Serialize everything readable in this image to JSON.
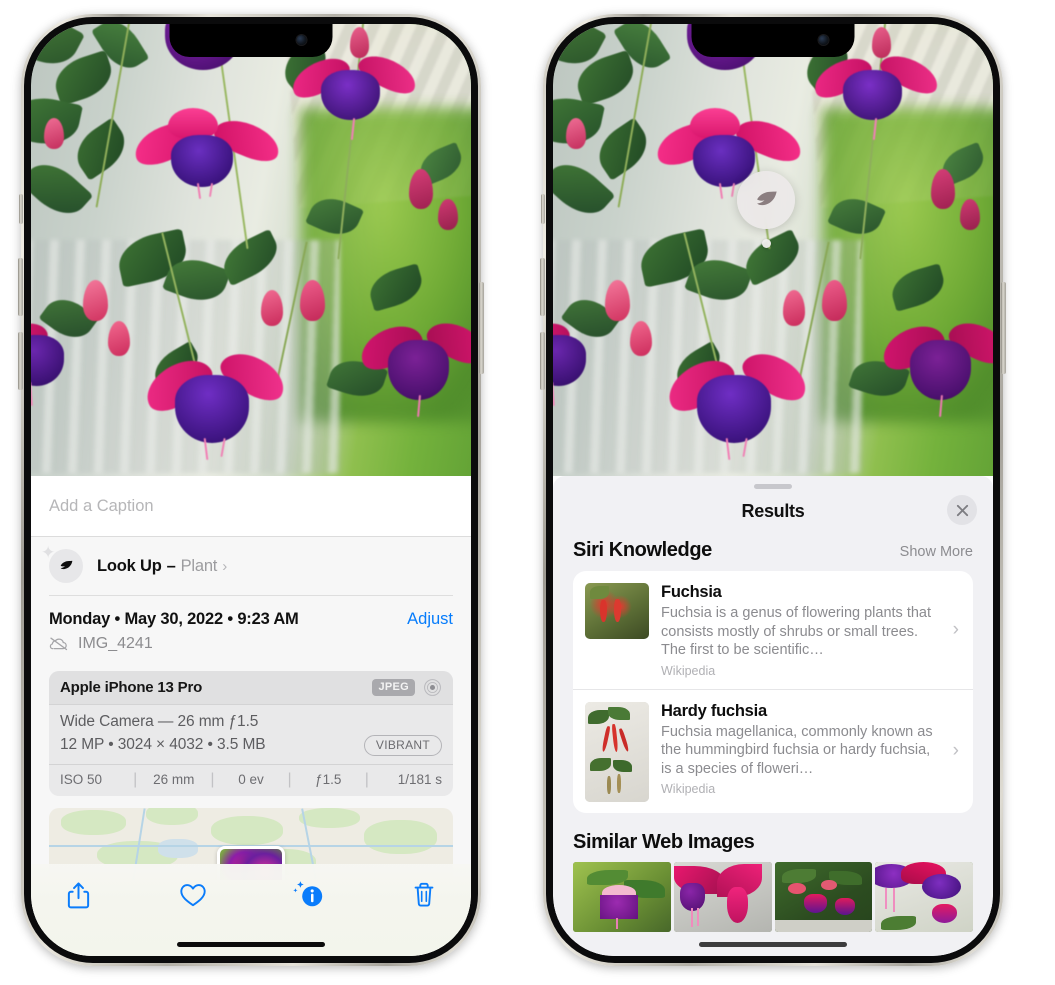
{
  "screenshot": {
    "description": "Two iPhone 13 Pro screenshots side by side showing Apple Photos Visual Look Up for a fuchsia plant"
  },
  "left_phone": {
    "device_name": "iPhone 13 Pro",
    "photo": {
      "subject": "fuchsia flowers",
      "alt": "Close-up of pink and purple fuchsia blossoms hanging from a plant on a porch"
    },
    "caption_field": {
      "placeholder": "Add a Caption",
      "value": ""
    },
    "lookup_row": {
      "icon": "leaf-icon",
      "sparkle_icon": "sparkle-icon",
      "label": "Look Up",
      "separator": "–",
      "subject": "Plant",
      "chevron": "›"
    },
    "date_row": {
      "weekday": "Monday",
      "dot1": "•",
      "date": "May 30, 2022",
      "dot2": "•",
      "time": "9:23 AM",
      "full": "Monday • May 30, 2022 • 9:23 AM",
      "adjust_label": "Adjust"
    },
    "file_row": {
      "icon": "cloud-slash-icon",
      "filename": "IMG_4241"
    },
    "camera_card": {
      "model": "Apple iPhone 13 Pro",
      "format_badge": "JPEG",
      "hdr_icon": "hdr-aperture-icon",
      "lens": "Wide Camera — 26 mm ƒ1.5",
      "specs": "12 MP • 3024 × 4032 • 3.5 MB",
      "style_badge": "VIBRANT",
      "exif": [
        "ISO 50",
        "26 mm",
        "0 ev",
        "ƒ1.5",
        "1/181 s"
      ]
    },
    "map": {
      "label": "location-map-thumbnail"
    },
    "toolbar": [
      {
        "name": "share-icon",
        "label": "Share"
      },
      {
        "name": "heart-icon",
        "label": "Favorite"
      },
      {
        "name": "info-sparkle-icon",
        "label": "Info"
      },
      {
        "name": "trash-icon",
        "label": "Delete"
      }
    ],
    "accent_color": "#067cfb"
  },
  "right_phone": {
    "device_name": "iPhone 13 Pro",
    "visual_look_up_badge": {
      "icon": "leaf-icon",
      "label": "Visual Look Up indicator"
    },
    "sheet": {
      "grabber": "drag-handle",
      "title": "Results",
      "close_icon": "close-icon"
    },
    "siri_knowledge": {
      "section_title": "Siri Knowledge",
      "show_more_label": "Show More",
      "results": [
        {
          "title": "Fuchsia",
          "description": "Fuchsia is a genus of flowering plants that consists mostly of shrubs or small trees. The first to be scientific…",
          "source": "Wikipedia",
          "chevron": "›",
          "thumb": "fuchsia-thumbnail"
        },
        {
          "title": "Hardy fuchsia",
          "description": "Fuchsia magellanica, commonly known as the hummingbird fuchsia or hardy fuchsia, is a species of floweri…",
          "source": "Wikipedia",
          "chevron": "›",
          "thumb": "hardy-fuchsia-thumbnail"
        }
      ]
    },
    "similar_web_images": {
      "section_title": "Similar Web Images",
      "tiles": [
        "fuchsia-web-image-1",
        "fuchsia-web-image-2",
        "fuchsia-web-image-3",
        "fuchsia-web-image-4"
      ]
    }
  },
  "colors": {
    "accent_blue": "#067cfb",
    "sheet_background": "#f1f1f4",
    "card_background": "#ffffff",
    "secondary_text": "#8b8b8f",
    "camera_card_background": "#e9e9ea"
  }
}
